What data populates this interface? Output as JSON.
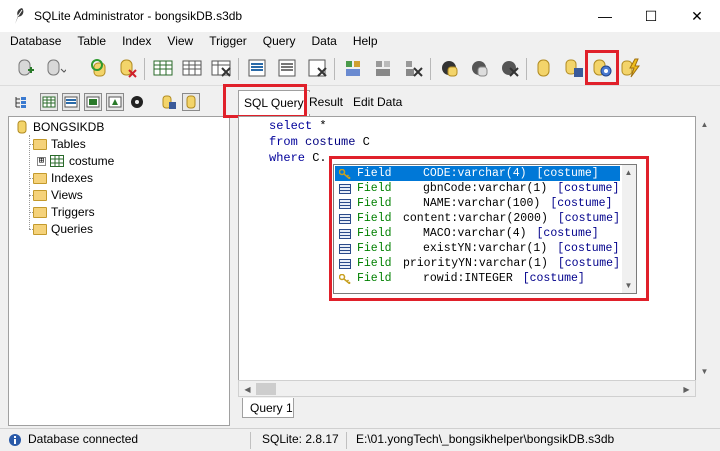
{
  "window": {
    "title": "SQLite Administrator - bongsikDB.s3db",
    "minimize": "—",
    "maximize": "☐",
    "close": "✕"
  },
  "menu": [
    "Database",
    "Table",
    "Index",
    "View",
    "Trigger",
    "Query",
    "Data",
    "Help"
  ],
  "tree": {
    "root": "BONGSIKDB",
    "tables_label": "Tables",
    "table_name": "costume",
    "indexes_label": "Indexes",
    "views_label": "Views",
    "triggers_label": "Triggers",
    "queries_label": "Queries",
    "expander": "⊞"
  },
  "tabs": {
    "sql_query": "SQL Query",
    "result": "Result",
    "edit_data": "Edit Data"
  },
  "editor": {
    "line1_kw": "select",
    "line1_rest": " *",
    "line2_kw": "from",
    "line2_ident": " costume",
    "line2_rest": " C",
    "line3_kw": "where",
    "line3_rest": " C."
  },
  "autocomplete": [
    {
      "kind": "Field",
      "text": "CODE:varchar(4)",
      "table": "[costume]",
      "key": true,
      "selected": true
    },
    {
      "kind": "Field",
      "text": "gbnCode:varchar(1)",
      "table": "[costume]",
      "key": false,
      "selected": false
    },
    {
      "kind": "Field",
      "text": "NAME:varchar(100)",
      "table": "[costume]",
      "key": false,
      "selected": false
    },
    {
      "kind": "Field",
      "text": "content:varchar(2000)",
      "table": "[costume]",
      "key": false,
      "selected": false
    },
    {
      "kind": "Field",
      "text": "MACO:varchar(4)",
      "table": "[costume]",
      "key": false,
      "selected": false
    },
    {
      "kind": "Field",
      "text": "existYN:varchar(1)",
      "table": "[costume]",
      "key": false,
      "selected": false
    },
    {
      "kind": "Field",
      "text": "priorityYN:varchar(1)",
      "table": "[costume]",
      "key": false,
      "selected": false
    },
    {
      "kind": "Field",
      "text": "rowid:INTEGER",
      "table": "[costume]",
      "key": true,
      "selected": false
    }
  ],
  "query_tab": "Query 1",
  "status": {
    "connection": "Database connected",
    "version": "SQLite: 2.8.17",
    "path": "E:\\01.yongTech\\_bongsikhelper\\bongsikDB.s3db"
  },
  "colors": {
    "highlight": "#e0202a",
    "selection": "#0078d7",
    "keyword": "#00009a",
    "field_kind": "#008000"
  }
}
